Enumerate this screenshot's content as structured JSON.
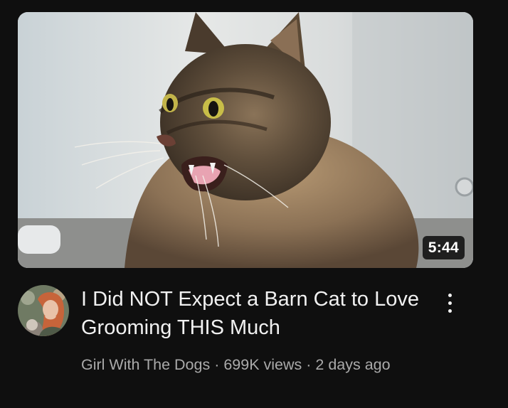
{
  "video": {
    "title": "I Did NOT Expect a Barn Cat to Love Grooming THIS Much",
    "duration": "5:44",
    "thumbnail_icon": "cat-photo-thumbnail",
    "channel_avatar_icon": "channel-avatar"
  },
  "meta": {
    "channel": "Girl With The Dogs",
    "separator": " · ",
    "views": "699K views",
    "age": "2 days ago"
  },
  "menu_icon": "more-vertical-icon",
  "colors": {
    "background": "#0f0f0f",
    "title": "#f1f1f1",
    "meta": "#aaaaaa",
    "duration_bg": "#000000"
  }
}
